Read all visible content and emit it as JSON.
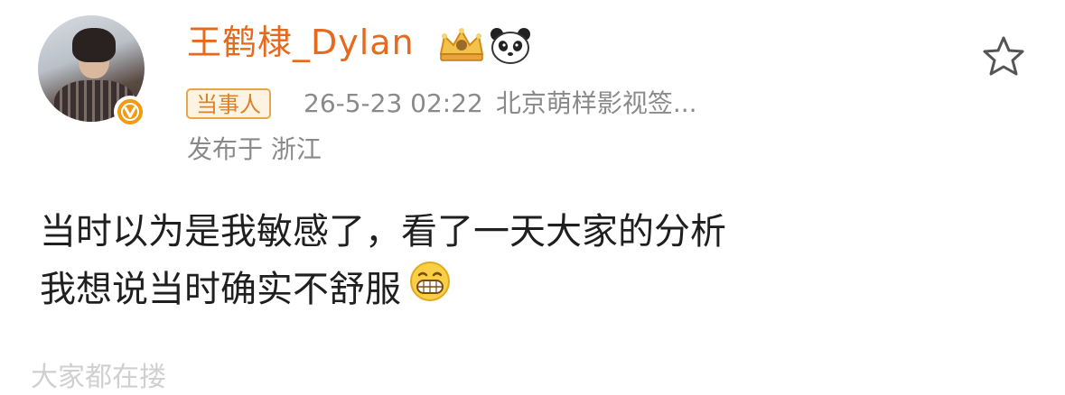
{
  "post": {
    "username": "王鹤棣_Dylan",
    "badges": [
      "crown-icon",
      "panda-icon"
    ],
    "verified_badge_icon": "verified-v-icon",
    "role_tag": "当事人",
    "timestamp": "26-5-23 02:22",
    "source": "北京萌样影视签...",
    "location": "发布于 浙江",
    "content": {
      "line1": "当时以为是我敏感了，看了一天大家的分析",
      "line2": "我想说当时确实不舒服",
      "emoji": "grinning-face-icon"
    },
    "favorite_icon": "star-outline-icon",
    "next_text_cutoff": "大家都在搂"
  },
  "colors": {
    "username": "#e66a1e",
    "tag_border": "#e8a64a",
    "tag_text": "#d9822b",
    "meta_gray": "#8a8a8a",
    "badge_orange": "#f29a12"
  }
}
